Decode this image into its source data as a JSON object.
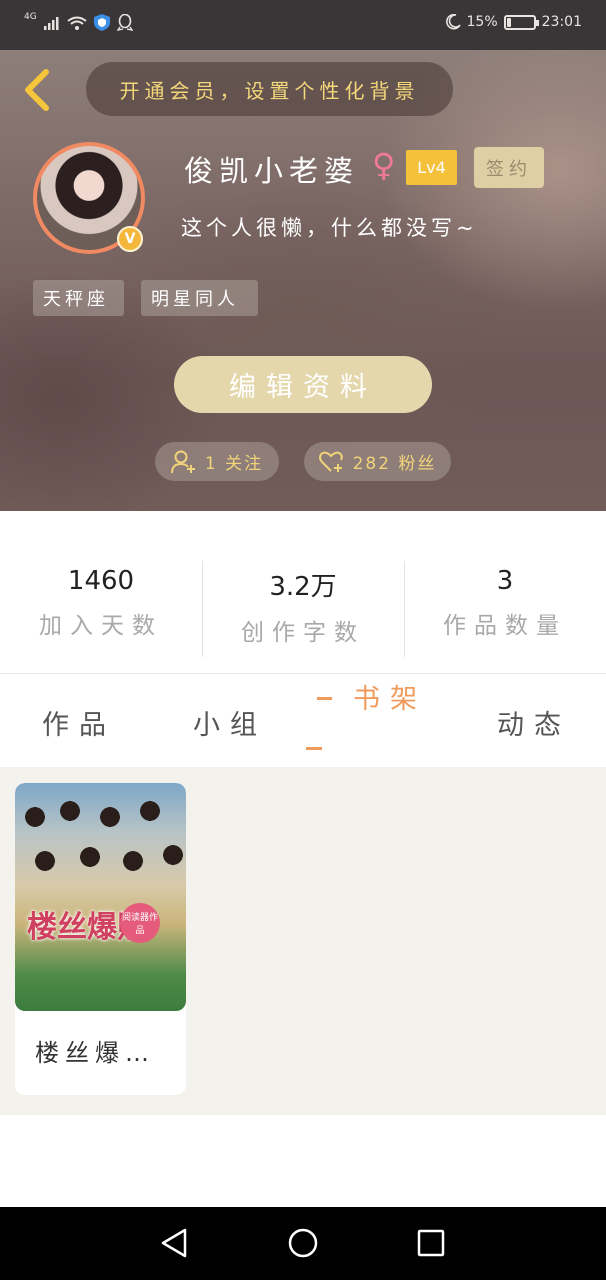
{
  "status_bar": {
    "network": "4G",
    "battery_percent": "15%",
    "battery_level": 0.15,
    "time": "23:01",
    "icons": [
      "signal-icon",
      "wifi-icon",
      "shield-icon",
      "qq-icon",
      "moon-icon",
      "battery-icon"
    ]
  },
  "header": {
    "back_icon": "chevron-left-icon",
    "vip_banner": "开通会员，设置个性化背景",
    "username": "俊凯小老婆",
    "gender_symbol": "♀",
    "level_badge": "Lv4",
    "sign_badge": "签约",
    "verified_badge": "V",
    "bio": "这个人很懒，什么都没写~",
    "tags": [
      "天秤座",
      "明星同人"
    ],
    "edit_button": "编辑资料",
    "following": {
      "icon": "add-user-icon",
      "label": "1 关注"
    },
    "followers": {
      "icon": "heart-icon",
      "label": "282 粉丝"
    }
  },
  "stats": [
    {
      "value": "1460",
      "label": "加入天数"
    },
    {
      "value": "3.2万",
      "label": "创作字数"
    },
    {
      "value": "3",
      "label": "作品数量"
    }
  ],
  "tabs": [
    {
      "label": "作品",
      "active": false
    },
    {
      "label": "小组",
      "active": false
    },
    {
      "label": "书架",
      "active": true
    },
    {
      "label": "动态",
      "active": false
    }
  ],
  "bookshelf": [
    {
      "title": "楼丝爆…",
      "cover_text": "楼丝爆照",
      "cover_badge": "阅读器作品"
    }
  ],
  "colors": {
    "accent": "#f09a5c",
    "gold": "#f1d37a",
    "level_badge": "#f5c13a",
    "edit_button": "#e4d7ab",
    "gender": "#f0799a"
  },
  "nav_bar": [
    "back-triangle-icon",
    "home-circle-icon",
    "recents-square-icon"
  ]
}
